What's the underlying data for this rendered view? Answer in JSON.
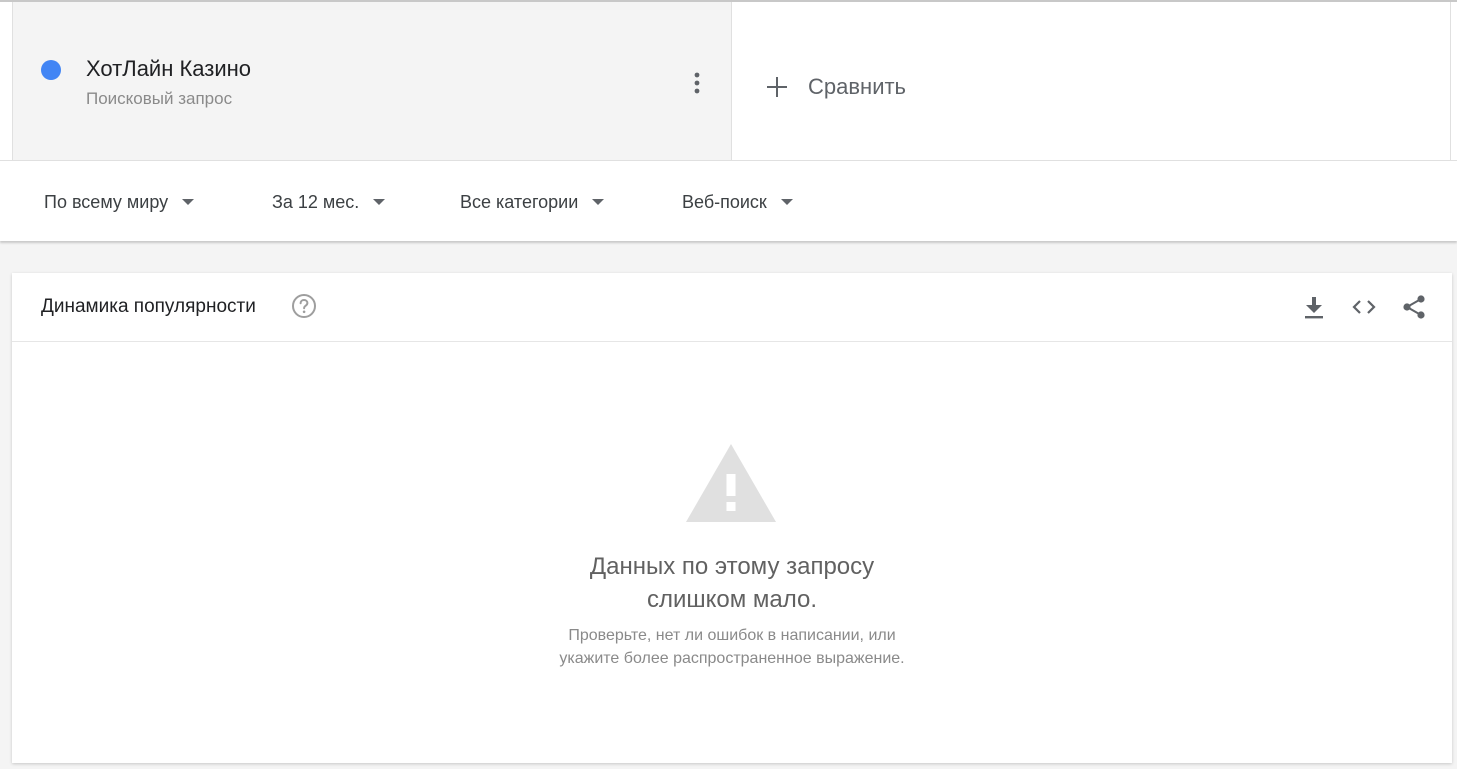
{
  "term": {
    "name": "ХотЛайн Казино",
    "type": "Поисковый запрос",
    "color": "#4285f4",
    "menu_icon": "more-vert-icon"
  },
  "compare": {
    "label": "Сравнить",
    "icon": "plus-icon"
  },
  "filters": [
    {
      "label": "По всему миру"
    },
    {
      "label": "За 12 мес."
    },
    {
      "label": "Все категории"
    },
    {
      "label": "Веб-поиск"
    }
  ],
  "trend": {
    "title": "Динамика популярности",
    "help_icon": "help-circle-icon",
    "actions": {
      "download_icon": "download-icon",
      "embed_icon": "embed-code-icon",
      "share_icon": "share-icon"
    },
    "empty": {
      "icon": "warning-icon",
      "title_line1": "Данных по этому запросу",
      "title_line2": "слишком мало.",
      "hint_line1": "Проверьте, нет ли ошибок в написании, или",
      "hint_line2": "укажите более распространенное выражение."
    }
  }
}
